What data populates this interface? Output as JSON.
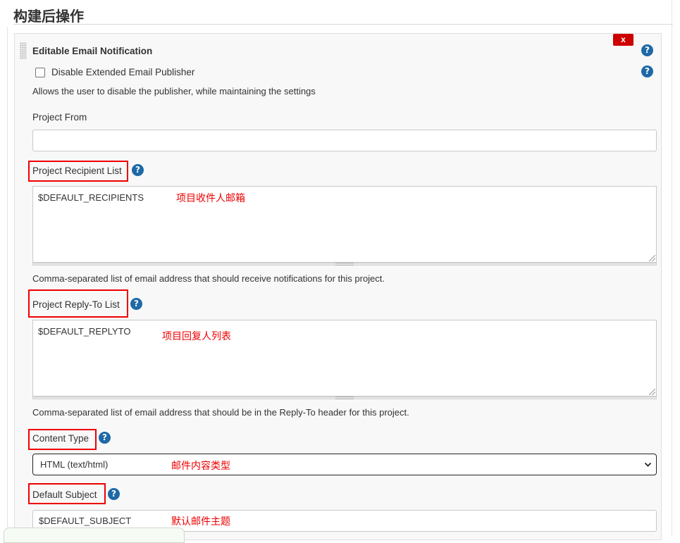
{
  "section": {
    "title": "构建后操作"
  },
  "plugin": {
    "title": "Editable Email Notification",
    "delete_label": "x",
    "help_glyph": "?",
    "disable_checkbox": {
      "label": "Disable Extended Email Publisher",
      "checked": false,
      "description": "Allows the user to disable the publisher, while maintaining the settings"
    },
    "project_from": {
      "label": "Project From",
      "value": ""
    },
    "recipient_list": {
      "label": "Project Recipient List",
      "value": "$DEFAULT_RECIPIENTS",
      "annotation": "项目收件人邮箱",
      "description": "Comma-separated list of email address that should receive notifications for this project."
    },
    "reply_to_list": {
      "label": "Project Reply-To List",
      "value": "$DEFAULT_REPLYTO",
      "annotation": "项目回复人列表",
      "description": "Comma-separated list of email address that should be in the Reply-To header for this project."
    },
    "content_type": {
      "label": "Content Type",
      "selected": "HTML (text/html)",
      "annotation": "邮件内容类型"
    },
    "default_subject": {
      "label": "Default Subject",
      "value": "$DEFAULT_SUBJECT",
      "annotation": "默认邮件主题"
    }
  },
  "colors": {
    "help_icon": "#1e69a6",
    "delete_button": "#cc0000",
    "annotation_red": "#ee0000"
  }
}
